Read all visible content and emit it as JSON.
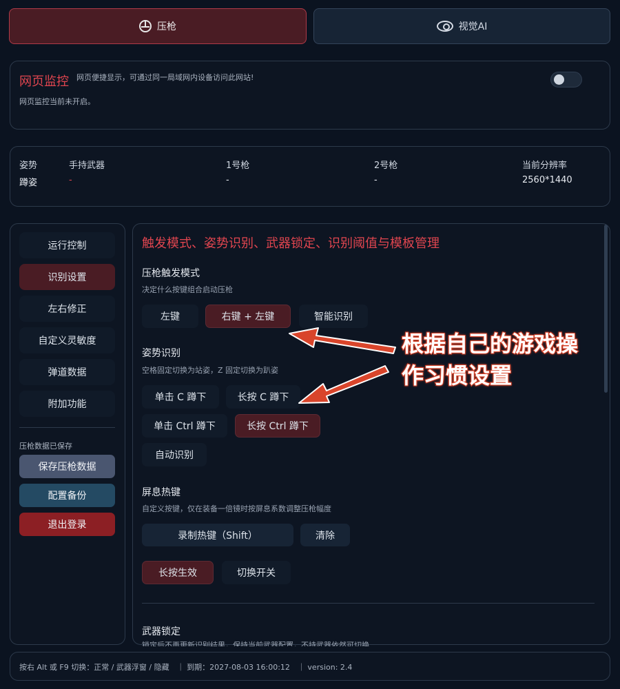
{
  "tabs": [
    {
      "label": "压枪",
      "icon": "crosshair-icon",
      "active": true
    },
    {
      "label": "视觉AI",
      "icon": "eye-ai-icon",
      "active": false
    }
  ],
  "web_monitor": {
    "title": "网页监控",
    "description": "网页便捷显示，可通过同一局域网内设备访问此网站!",
    "status": "网页监控当前未开启。",
    "enabled": false
  },
  "info": {
    "labels": [
      "姿势",
      "手持武器",
      "1号枪",
      "2号枪",
      "当前分辨率"
    ],
    "values": [
      "蹲姿",
      "-",
      "-",
      "-",
      "2560*1440"
    ]
  },
  "sidebar": {
    "items": [
      {
        "label": "运行控制",
        "active": false
      },
      {
        "label": "识别设置",
        "active": true
      },
      {
        "label": "左右修正",
        "active": false
      },
      {
        "label": "自定义灵敏度",
        "active": false
      },
      {
        "label": "弹道数据",
        "active": false
      },
      {
        "label": "附加功能",
        "active": false
      }
    ],
    "note": "压枪数据已保存",
    "save_label": "保存压枪数据",
    "backup_label": "配置备份",
    "logout_label": "退出登录"
  },
  "main": {
    "title": "触发模式、姿势识别、武器锁定、识别阈值与模板管理",
    "trigger": {
      "title": "压枪触发模式",
      "desc": "决定什么按键组合启动压枪",
      "options": [
        "左键",
        "右键 + 左键",
        "智能识别"
      ],
      "selected": "右键 + 左键"
    },
    "posture": {
      "title": "姿势识别",
      "desc": "空格固定切换为站姿，Z 固定切换为趴姿",
      "options": [
        "单击 C 蹲下",
        "长按 C 蹲下",
        "单击 Ctrl 蹲下",
        "长按 Ctrl 蹲下",
        "自动识别"
      ],
      "selected": "长按 Ctrl 蹲下"
    },
    "hotkey": {
      "title": "屏息热键",
      "desc": "自定义按键，仅在装备一倍镜时按屏息系数调整压枪幅度",
      "record_label": "录制热键（Shift）",
      "clear_label": "清除",
      "mode_options": [
        "长按生效",
        "切换开关"
      ],
      "mode_selected": "长按生效"
    },
    "weapon_lock": {
      "title": "武器锁定",
      "desc": "锁定后不再更新识别结果，保持当前武器配置，不持武器依然可切换"
    }
  },
  "annotation": {
    "line1": "根据自己的游戏操",
    "line2": "作习惯设置",
    "color": "#d9452b"
  },
  "footer": {
    "text": "按右 Alt 或 F9 切换：正常 / 武器浮窗 / 隐藏　｜ 到期：2027-08-03 16:00:12　｜ version: 2.4"
  },
  "colors": {
    "accent_red": "#e0454f",
    "active_bg": "#4a1c24",
    "background": "#0b1320"
  }
}
